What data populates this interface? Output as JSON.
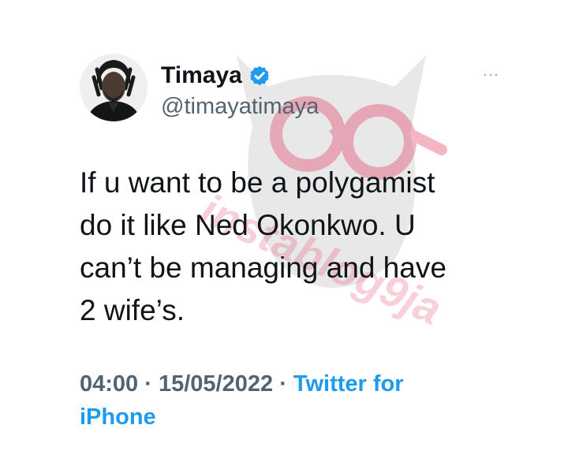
{
  "tweet": {
    "display_name": "Timaya",
    "handle": "@timayatimaya",
    "verified": true,
    "text_lines": [
      "If u want to be a polygamist",
      "do it like Ned Okonkwo.  U",
      "can’t be managing and have",
      "2 wife’s."
    ],
    "time": "04:00",
    "separator": "·",
    "date": "15/05/2022",
    "source_line1": "Twitter for",
    "source_line2": "iPhone",
    "more_glyph": "···"
  },
  "watermark": {
    "text": "instablog9ja",
    "text_color": "#e0305a",
    "owl_color": "#8a8a8a",
    "glasses_color": "#e0305a"
  },
  "colors": {
    "name": "#0f1419",
    "handle": "#536471",
    "link": "#1d9bf0",
    "verified": "#1d9bf0"
  },
  "icons": {
    "verified": "verified-badge-icon",
    "more": "more-options-icon",
    "avatar": "profile-photo"
  }
}
